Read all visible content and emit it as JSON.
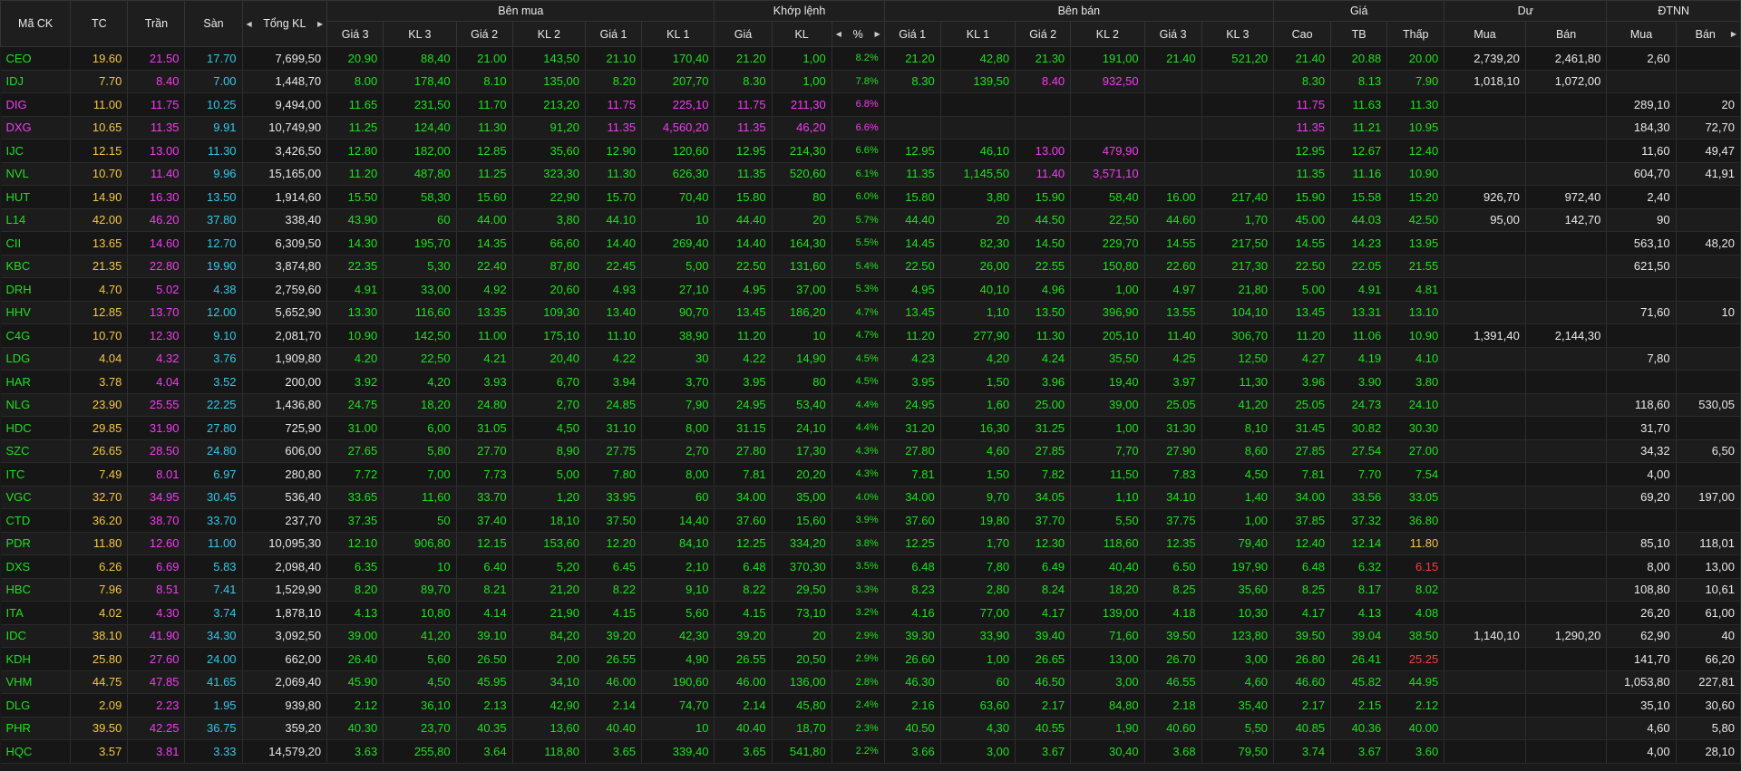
{
  "headers": {
    "symbol": "Mã CK",
    "tc": "TC",
    "tran": "Trần",
    "san": "Sàn",
    "tongkl": "Tổng KL",
    "ben_mua": "Bên mua",
    "khop_lenh": "Khớp lệnh",
    "ben_ban": "Bên bán",
    "gia": "Giá",
    "du": "Dư",
    "dtnn": "ĐTNN",
    "buy_cols": [
      "Giá 3",
      "KL 3",
      "Giá 2",
      "KL 2",
      "Giá 1",
      "KL 1"
    ],
    "match_cols": [
      "Giá",
      "KL",
      "%"
    ],
    "sell_cols": [
      "Giá 1",
      "KL 1",
      "Giá 2",
      "KL 2",
      "Giá 3",
      "KL 3"
    ],
    "price_cols": [
      "Cao",
      "TB",
      "Thấp"
    ],
    "du_cols": [
      "Mua",
      "Bán"
    ],
    "dtnn_cols": [
      "Mua",
      "Bán"
    ]
  },
  "colors": {
    "up": "#1fe01f",
    "ref": "#f5c542",
    "ceil": "#f23cf2",
    "floor": "#33c8e8",
    "down": "#ff3b3b"
  },
  "rows": [
    [
      "CEO",
      "19.60",
      "21.50",
      "17.70",
      "7,699,50",
      "20.90",
      "88,40",
      "21.00",
      "143,50",
      "21.10",
      "170,40",
      "21.20",
      "1,00",
      "8.2%",
      "21.20",
      "42,80",
      "21.30",
      "191,00",
      "21.40",
      "521,20",
      "21.40",
      "20.88",
      "20.00",
      "2,739,20",
      "2,461,80",
      "2,60",
      ""
    ],
    [
      "IDJ",
      "7.70",
      "8.40",
      "7.00",
      "1,448,70",
      "8.00",
      "178,40",
      "8.10",
      "135,00",
      "8.20",
      "207,70",
      "8.30",
      "1,00",
      "7.8%",
      "8.30",
      "139,50",
      "8.40",
      "932,50",
      "",
      "",
      "8.30",
      "8.13",
      "7.90",
      "1,018,10",
      "1,072,00",
      "",
      ""
    ],
    [
      "DIG",
      "11.00",
      "11.75",
      "10.25",
      "9,494,00",
      "11.65",
      "231,50",
      "11.70",
      "213,20",
      "11.75",
      "225,10",
      "11.75",
      "211,30",
      "6.8%",
      "",
      "",
      "",
      "",
      "",
      "",
      "11.75",
      "11.63",
      "11.30",
      "",
      "",
      "289,10",
      "20"
    ],
    [
      "DXG",
      "10.65",
      "11.35",
      "9.91",
      "10,749,90",
      "11.25",
      "124,40",
      "11.30",
      "91,20",
      "11.35",
      "4,560,20",
      "11.35",
      "46,20",
      "6.6%",
      "",
      "",
      "",
      "",
      "",
      "",
      "11.35",
      "11.21",
      "10.95",
      "",
      "",
      "184,30",
      "72,70"
    ],
    [
      "IJC",
      "12.15",
      "13.00",
      "11.30",
      "3,426,50",
      "12.80",
      "182,00",
      "12.85",
      "35,60",
      "12.90",
      "120,60",
      "12.95",
      "214,30",
      "6.6%",
      "12.95",
      "46,10",
      "13.00",
      "479,90",
      "",
      "",
      "12.95",
      "12.67",
      "12.40",
      "",
      "",
      "11,60",
      "49,47"
    ],
    [
      "NVL",
      "10.70",
      "11.40",
      "9.96",
      "15,165,00",
      "11.20",
      "487,80",
      "11.25",
      "323,30",
      "11.30",
      "626,30",
      "11.35",
      "520,60",
      "6.1%",
      "11.35",
      "1,145,50",
      "11.40",
      "3,571,10",
      "",
      "",
      "11.35",
      "11.16",
      "10.90",
      "",
      "",
      "604,70",
      "41,91"
    ],
    [
      "HUT",
      "14.90",
      "16.30",
      "13.50",
      "1,914,60",
      "15.50",
      "58,30",
      "15.60",
      "22,90",
      "15.70",
      "70,40",
      "15.80",
      "80",
      "6.0%",
      "15.80",
      "3,80",
      "15.90",
      "58,40",
      "16.00",
      "217,40",
      "15.90",
      "15.58",
      "15.20",
      "926,70",
      "972,40",
      "2,40",
      ""
    ],
    [
      "L14",
      "42.00",
      "46.20",
      "37.80",
      "338,40",
      "43.90",
      "60",
      "44.00",
      "3,80",
      "44.10",
      "10",
      "44.40",
      "20",
      "5.7%",
      "44.40",
      "20",
      "44.50",
      "22,50",
      "44.60",
      "1,70",
      "45.00",
      "44.03",
      "42.50",
      "95,00",
      "142,70",
      "90",
      ""
    ],
    [
      "CII",
      "13.65",
      "14.60",
      "12.70",
      "6,309,50",
      "14.30",
      "195,70",
      "14.35",
      "66,60",
      "14.40",
      "269,40",
      "14.40",
      "164,30",
      "5.5%",
      "14.45",
      "82,30",
      "14.50",
      "229,70",
      "14.55",
      "217,50",
      "14.55",
      "14.23",
      "13.95",
      "",
      "",
      "563,10",
      "48,20"
    ],
    [
      "KBC",
      "21.35",
      "22.80",
      "19.90",
      "3,874,80",
      "22.35",
      "5,30",
      "22.40",
      "87,80",
      "22.45",
      "5,00",
      "22.50",
      "131,60",
      "5.4%",
      "22.50",
      "26,00",
      "22.55",
      "150,80",
      "22.60",
      "217,30",
      "22.50",
      "22.05",
      "21.55",
      "",
      "",
      "621,50",
      ""
    ],
    [
      "DRH",
      "4.70",
      "5.02",
      "4.38",
      "2,759,60",
      "4.91",
      "33,00",
      "4.92",
      "20,60",
      "4.93",
      "27,10",
      "4.95",
      "37,00",
      "5.3%",
      "4.95",
      "40,10",
      "4.96",
      "1,00",
      "4.97",
      "21,80",
      "5.00",
      "4.91",
      "4.81",
      "",
      "",
      "",
      ""
    ],
    [
      "HHV",
      "12.85",
      "13.70",
      "12.00",
      "5,652,90",
      "13.30",
      "116,60",
      "13.35",
      "109,30",
      "13.40",
      "90,70",
      "13.45",
      "186,20",
      "4.7%",
      "13.45",
      "1,10",
      "13.50",
      "396,90",
      "13.55",
      "104,10",
      "13.45",
      "13.31",
      "13.10",
      "",
      "",
      "71,60",
      "10"
    ],
    [
      "C4G",
      "10.70",
      "12.30",
      "9.10",
      "2,081,70",
      "10.90",
      "142,50",
      "11.00",
      "175,10",
      "11.10",
      "38,90",
      "11.20",
      "10",
      "4.7%",
      "11.20",
      "277,90",
      "11.30",
      "205,10",
      "11.40",
      "306,70",
      "11.20",
      "11.06",
      "10.90",
      "1,391,40",
      "2,144,30",
      "",
      ""
    ],
    [
      "LDG",
      "4.04",
      "4.32",
      "3.76",
      "1,909,80",
      "4.20",
      "22,50",
      "4.21",
      "20,40",
      "4.22",
      "30",
      "4.22",
      "14,90",
      "4.5%",
      "4.23",
      "4,20",
      "4.24",
      "35,50",
      "4.25",
      "12,50",
      "4.27",
      "4.19",
      "4.10",
      "",
      "",
      "7,80",
      ""
    ],
    [
      "HAR",
      "3.78",
      "4.04",
      "3.52",
      "200,00",
      "3.92",
      "4,20",
      "3.93",
      "6,70",
      "3.94",
      "3,70",
      "3.95",
      "80",
      "4.5%",
      "3.95",
      "1,50",
      "3.96",
      "19,40",
      "3.97",
      "11,30",
      "3.96",
      "3.90",
      "3.80",
      "",
      "",
      "",
      ""
    ],
    [
      "NLG",
      "23.90",
      "25.55",
      "22.25",
      "1,436,80",
      "24.75",
      "18,20",
      "24.80",
      "2,70",
      "24.85",
      "7,90",
      "24.95",
      "53,40",
      "4.4%",
      "24.95",
      "1,60",
      "25.00",
      "39,00",
      "25.05",
      "41,20",
      "25.05",
      "24.73",
      "24.10",
      "",
      "",
      "118,60",
      "530,05"
    ],
    [
      "HDC",
      "29.85",
      "31.90",
      "27.80",
      "725,90",
      "31.00",
      "6,00",
      "31.05",
      "4,50",
      "31.10",
      "8,00",
      "31.15",
      "24,10",
      "4.4%",
      "31.20",
      "16,30",
      "31.25",
      "1,00",
      "31.30",
      "8,10",
      "31.45",
      "30.82",
      "30.30",
      "",
      "",
      "31,70",
      ""
    ],
    [
      "SZC",
      "26.65",
      "28.50",
      "24.80",
      "606,00",
      "27.65",
      "5,80",
      "27.70",
      "8,90",
      "27.75",
      "2,70",
      "27.80",
      "17,30",
      "4.3%",
      "27.80",
      "4,60",
      "27.85",
      "7,70",
      "27.90",
      "8,60",
      "27.85",
      "27.54",
      "27.00",
      "",
      "",
      "34,32",
      "6,50"
    ],
    [
      "ITC",
      "7.49",
      "8.01",
      "6.97",
      "280,80",
      "7.72",
      "7,00",
      "7.73",
      "5,00",
      "7.80",
      "8,00",
      "7.81",
      "20,20",
      "4.3%",
      "7.81",
      "1,50",
      "7.82",
      "11,50",
      "7.83",
      "4,50",
      "7.81",
      "7.70",
      "7.54",
      "",
      "",
      "4,00",
      ""
    ],
    [
      "VGC",
      "32.70",
      "34.95",
      "30.45",
      "536,40",
      "33.65",
      "11,60",
      "33.70",
      "1,20",
      "33.95",
      "60",
      "34.00",
      "35,00",
      "4.0%",
      "34.00",
      "9,70",
      "34.05",
      "1,10",
      "34.10",
      "1,40",
      "34.00",
      "33.56",
      "33.05",
      "",
      "",
      "69,20",
      "197,00"
    ],
    [
      "CTD",
      "36.20",
      "38.70",
      "33.70",
      "237,70",
      "37.35",
      "50",
      "37.40",
      "18,10",
      "37.50",
      "14,40",
      "37.60",
      "15,60",
      "3.9%",
      "37.60",
      "19,80",
      "37.70",
      "5,50",
      "37.75",
      "1,00",
      "37.85",
      "37.32",
      "36.80",
      "",
      "",
      "",
      ""
    ],
    [
      "PDR",
      "11.80",
      "12.60",
      "11.00",
      "10,095,30",
      "12.10",
      "906,80",
      "12.15",
      "153,60",
      "12.20",
      "84,10",
      "12.25",
      "334,20",
      "3.8%",
      "12.25",
      "1,70",
      "12.30",
      "118,60",
      "12.35",
      "79,40",
      "12.40",
      "12.14",
      "11.80",
      "",
      "",
      "85,10",
      "118,01"
    ],
    [
      "DXS",
      "6.26",
      "6.69",
      "5.83",
      "2,098,40",
      "6.35",
      "10",
      "6.40",
      "5,20",
      "6.45",
      "2,10",
      "6.48",
      "370,30",
      "3.5%",
      "6.48",
      "7,80",
      "6.49",
      "40,40",
      "6.50",
      "197,90",
      "6.48",
      "6.32",
      "6.15",
      "",
      "",
      "8,00",
      "13,00"
    ],
    [
      "HBC",
      "7.96",
      "8.51",
      "7.41",
      "1,529,90",
      "8.20",
      "89,70",
      "8.21",
      "21,20",
      "8.22",
      "9,10",
      "8.22",
      "29,50",
      "3.3%",
      "8.23",
      "2,80",
      "8.24",
      "18,20",
      "8.25",
      "35,60",
      "8.25",
      "8.17",
      "8.02",
      "",
      "",
      "108,80",
      "10,61"
    ],
    [
      "ITA",
      "4.02",
      "4.30",
      "3.74",
      "1,878,10",
      "4.13",
      "10,80",
      "4.14",
      "21,90",
      "4.15",
      "5,60",
      "4.15",
      "73,10",
      "3.2%",
      "4.16",
      "77,00",
      "4.17",
      "139,00",
      "4.18",
      "10,30",
      "4.17",
      "4.13",
      "4.08",
      "",
      "",
      "26,20",
      "61,00"
    ],
    [
      "IDC",
      "38.10",
      "41.90",
      "34.30",
      "3,092,50",
      "39.00",
      "41,20",
      "39.10",
      "84,20",
      "39.20",
      "42,30",
      "39.20",
      "20",
      "2.9%",
      "39.30",
      "33,90",
      "39.40",
      "71,60",
      "39.50",
      "123,80",
      "39.50",
      "39.04",
      "38.50",
      "1,140,10",
      "1,290,20",
      "62,90",
      "40"
    ],
    [
      "KDH",
      "25.80",
      "27.60",
      "24.00",
      "662,00",
      "26.40",
      "5,60",
      "26.50",
      "2,00",
      "26.55",
      "4,90",
      "26.55",
      "20,50",
      "2.9%",
      "26.60",
      "1,00",
      "26.65",
      "13,00",
      "26.70",
      "3,00",
      "26.80",
      "26.41",
      "25.25",
      "",
      "",
      "141,70",
      "66,20"
    ],
    [
      "VHM",
      "44.75",
      "47.85",
      "41.65",
      "2,069,40",
      "45.90",
      "4,50",
      "45.95",
      "34,10",
      "46.00",
      "190,60",
      "46.00",
      "136,00",
      "2.8%",
      "46.30",
      "60",
      "46.50",
      "3,00",
      "46.55",
      "4,60",
      "46.60",
      "45.82",
      "44.95",
      "",
      "",
      "1,053,80",
      "227,81"
    ],
    [
      "DLG",
      "2.09",
      "2.23",
      "1.95",
      "939,80",
      "2.12",
      "36,10",
      "2.13",
      "42,90",
      "2.14",
      "74,70",
      "2.14",
      "45,80",
      "2.4%",
      "2.16",
      "63,60",
      "2.17",
      "84,80",
      "2.18",
      "35,40",
      "2.17",
      "2.15",
      "2.12",
      "",
      "",
      "35,10",
      "30,60"
    ],
    [
      "PHR",
      "39.50",
      "42.25",
      "36.75",
      "359,20",
      "40.30",
      "23,70",
      "40.35",
      "13,60",
      "40.40",
      "10",
      "40.40",
      "18,70",
      "2.3%",
      "40.50",
      "4,30",
      "40.55",
      "1,90",
      "40.60",
      "5,50",
      "40.85",
      "40.36",
      "40.00",
      "",
      "",
      "4,60",
      "5,80"
    ],
    [
      "HQC",
      "3.57",
      "3.81",
      "3.33",
      "14,579,20",
      "3.63",
      "255,80",
      "3.64",
      "118,80",
      "3.65",
      "339,40",
      "3.65",
      "541,80",
      "2.2%",
      "3.66",
      "3,00",
      "3.67",
      "30,40",
      "3.68",
      "79,50",
      "3.74",
      "3.67",
      "3.60",
      "",
      "",
      "4,00",
      "28,10"
    ]
  ]
}
